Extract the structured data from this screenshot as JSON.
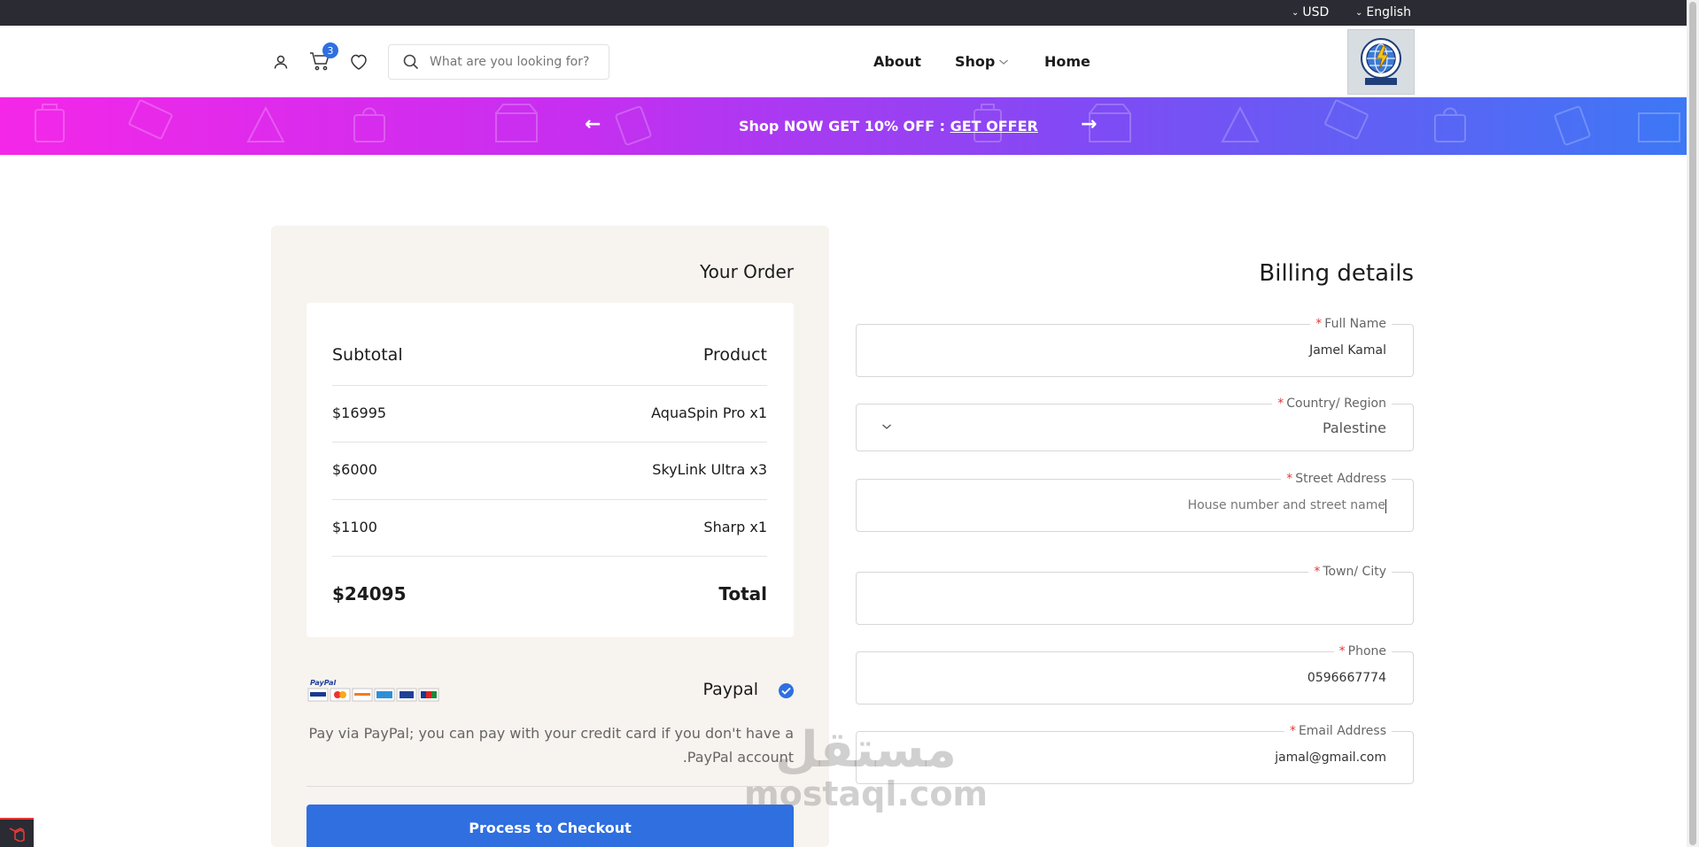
{
  "topbar": {
    "currency": "USD",
    "language": "English"
  },
  "header": {
    "cart_count": "3",
    "search_placeholder": "What are you looking for?",
    "nav": {
      "about": "About",
      "shop": "Shop",
      "home": "Home"
    }
  },
  "promo": {
    "text": "Shop NOW GET 10% OFF : ",
    "link": "GET OFFER"
  },
  "order": {
    "title": "Your Order",
    "col_subtotal": "Subtotal",
    "col_product": "Product",
    "items": [
      {
        "price": "$16995",
        "name": "AquaSpin Pro x1"
      },
      {
        "price": "$6000",
        "name": "SkyLink Ultra x3"
      },
      {
        "price": "$1100",
        "name": "Sharp x1"
      }
    ],
    "total_value": "$24095",
    "total_label": "Total",
    "payment_label": "Paypal",
    "payment_desc_1": "Pay via PayPal; you can pay with your credit card if you don't have a",
    "payment_desc_2": ".PayPal account",
    "checkout_label": "Process to Checkout"
  },
  "billing": {
    "title": "Billing details",
    "required_mark": "*",
    "full_name": {
      "label": "Full Name",
      "value": "Jamel Kamal"
    },
    "country": {
      "label": "Country/ Region",
      "value": "Palestine"
    },
    "street": {
      "label": "Street Address",
      "placeholder": "House number and street name"
    },
    "city": {
      "label": "Town/ City",
      "value": ""
    },
    "phone": {
      "label": "Phone",
      "value": "0596667774"
    },
    "email": {
      "label": "Email Address",
      "value": "jamal@gmail.com"
    }
  },
  "watermark": {
    "arabic": "مستقل",
    "latin": "mostaql.com"
  },
  "colors": {
    "accent": "#2f6fe0",
    "panel": "#f7f3ef",
    "topbar": "#2b2b33",
    "required": "#e23a3a"
  }
}
